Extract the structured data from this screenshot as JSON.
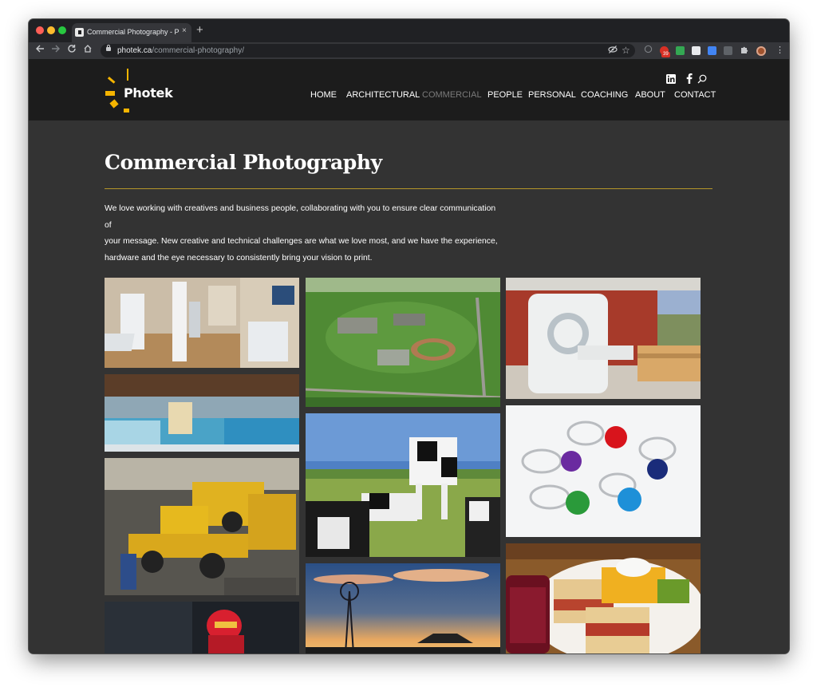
{
  "browser": {
    "tab_title": "Commercial Photography - Pho",
    "tab_close": "×",
    "new_tab": "+",
    "url_domain": "photek.ca",
    "url_path": "/commercial-photography/",
    "extension_badge": "39"
  },
  "site": {
    "logo_text": "Photek",
    "nav": [
      "HOME",
      "ARCHITECTURAL",
      "COMMERCIAL",
      "PEOPLE",
      "PERSONAL",
      "COACHING",
      "ABOUT",
      "CONTACT"
    ],
    "active_nav": "COMMERCIAL",
    "social_icons": [
      "linkedin-icon",
      "facebook-icon",
      "search-icon"
    ]
  },
  "content": {
    "title": "Commercial Photography",
    "intro_lines": [
      "We love working with creatives and business people, collaborating with you to ensure clear communication of",
      "your message. New creative and technical challenges are what we love most, and we have the experience,",
      "hardware and the eye necessary to consistently bring your vision to print."
    ]
  },
  "gallery": [
    {
      "name": "medical-imaging-room-photo"
    },
    {
      "name": "aerial-campus-photo"
    },
    {
      "name": "mri-scanner-photo"
    },
    {
      "name": "aquatic-centre-photo"
    },
    {
      "name": "holstein-cows-photo"
    },
    {
      "name": "glass-rings-photo"
    },
    {
      "name": "heavy-equipment-shop-photo"
    },
    {
      "name": "windmill-sunset-photo"
    },
    {
      "name": "smoked-meat-sandwich-photo"
    },
    {
      "name": "rescue-worker-helmet-photo"
    }
  ],
  "colors": {
    "page_bg": "#333333",
    "header_bg": "#1c1c1c",
    "accent_rule": "#b5962a",
    "logo_yellow": "#f5b400",
    "nav_active": "#7a7a7a"
  }
}
